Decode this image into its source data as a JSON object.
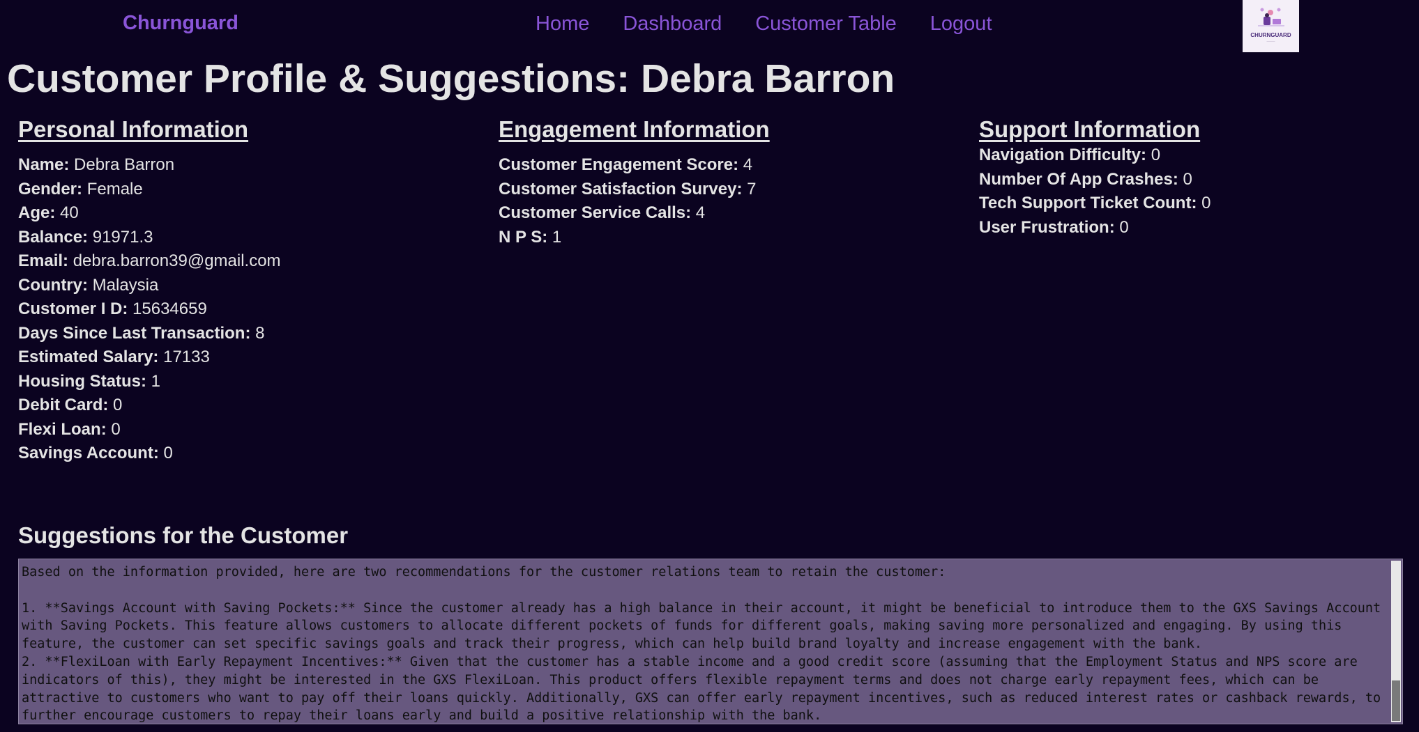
{
  "nav": {
    "brand": "Churnguard",
    "links": [
      "Home",
      "Dashboard",
      "Customer Table",
      "Logout"
    ],
    "logo_text": "CHURNGUARD"
  },
  "page_title": "Customer Profile & Suggestions: Debra Barron",
  "personal": {
    "heading": "Personal Information",
    "rows": [
      {
        "label": "Name:",
        "value": "Debra Barron"
      },
      {
        "label": "Gender:",
        "value": "Female"
      },
      {
        "label": "Age:",
        "value": "40"
      },
      {
        "label": "Balance:",
        "value": "91971.3"
      },
      {
        "label": "Email:",
        "value": "debra.barron39@gmail.com"
      },
      {
        "label": "Country:",
        "value": "Malaysia"
      },
      {
        "label": "Customer I D:",
        "value": "15634659"
      },
      {
        "label": "Days Since Last Transaction:",
        "value": "8"
      },
      {
        "label": "Estimated Salary:",
        "value": "17133"
      },
      {
        "label": "Housing Status:",
        "value": "1"
      },
      {
        "label": "Debit Card:",
        "value": "0"
      },
      {
        "label": "Flexi Loan:",
        "value": "0"
      },
      {
        "label": "Savings Account:",
        "value": "0"
      }
    ]
  },
  "engagement": {
    "heading": "Engagement Information",
    "rows": [
      {
        "label": "Customer Engagement Score:",
        "value": "4"
      },
      {
        "label": "Customer Satisfaction Survey:",
        "value": "7"
      },
      {
        "label": "Customer Service Calls:",
        "value": "4"
      },
      {
        "label": "N P S:",
        "value": "1"
      }
    ]
  },
  "support": {
    "heading": "Support Information",
    "rows": [
      {
        "label": "Navigation Difficulty:",
        "value": "0"
      },
      {
        "label": "Number Of App Crashes:",
        "value": "0"
      },
      {
        "label": "Tech Support Ticket Count:",
        "value": "0"
      },
      {
        "label": "User Frustration:",
        "value": "0"
      }
    ]
  },
  "suggestions": {
    "heading": "Suggestions for the Customer",
    "text": "Based on the information provided, here are two recommendations for the customer relations team to retain the customer:\n\n1. **Savings Account with Saving Pockets:** Since the customer already has a high balance in their account, it might be beneficial to introduce them to the GXS Savings Account with Saving Pockets. This feature allows customers to allocate different pockets of funds for different goals, making saving more personalized and engaging. By using this feature, the customer can set specific savings goals and track their progress, which can help build brand loyalty and increase engagement with the bank.\n2. **FlexiLoan with Early Repayment Incentives:** Given that the customer has a stable income and a good credit score (assuming that the Employment Status and NPS score are indicators of this), they might be interested in the GXS FlexiLoan. This product offers flexible repayment terms and does not charge early repayment fees, which can be attractive to customers who want to pay off their loans quickly. Additionally, GXS can offer early repayment incentives, such as reduced interest rates or cashback rewards, to further encourage customers to repay their loans early and build a positive relationship with the bank."
  }
}
